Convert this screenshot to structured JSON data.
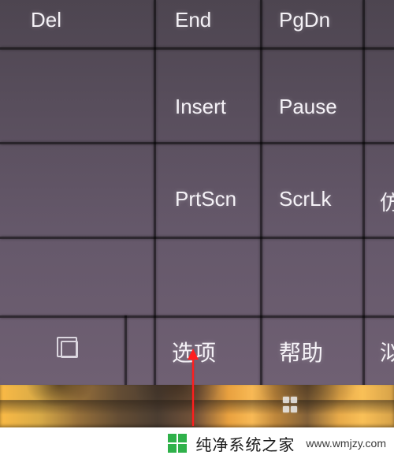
{
  "keys": {
    "del": "Del",
    "end": "End",
    "pgdn": "PgDn",
    "insert": "Insert",
    "pause": "Pause",
    "prtscn": "PrtScn",
    "scrlk": "ScrLk",
    "row3_partial": "仿",
    "options": "选项",
    "help": "帮助",
    "row4_partial": "泤"
  },
  "watermark": {
    "brand_name": "纯净系统之家",
    "url_label": "www.wmjzy.com"
  }
}
